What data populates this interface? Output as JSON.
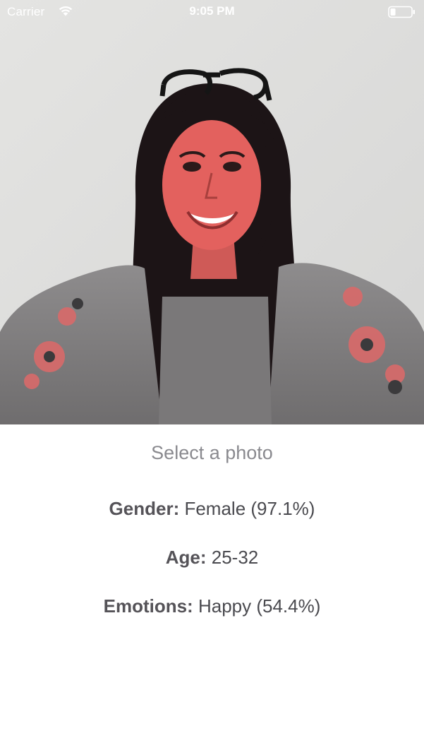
{
  "status_bar": {
    "carrier": "Carrier",
    "time": "9:05 PM",
    "wifi_icon": "wifi-icon",
    "battery_icon": "battery-low-icon"
  },
  "photo": {
    "subject": "portrait",
    "face_highlight_color": "#e85a5a"
  },
  "actions": {
    "select_photo_label": "Select a photo"
  },
  "results": {
    "gender_label": "Gender:",
    "gender_value": "Female (97.1%)",
    "age_label": "Age:",
    "age_value": "25-32",
    "emotions_label": "Emotions:",
    "emotions_value": "Happy (54.4%)"
  },
  "colors": {
    "background": "#ffffff",
    "button_text": "#8a8a8f",
    "result_text": "#4a4a4f"
  }
}
